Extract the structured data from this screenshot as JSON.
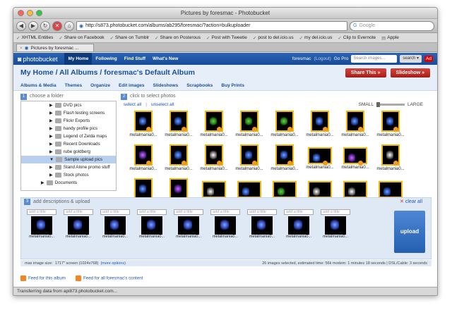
{
  "window": {
    "title": "Pictures by foresmac - Photobucket"
  },
  "browser": {
    "url": "http://s873.photobucket.com/albums/ab295/foresmac/?action=bulkuploader",
    "search_placeholder": "Google",
    "bookmarks": [
      "XHTML Entities",
      "Share on Facebook",
      "Share on Tumblr",
      "Share on Posterous",
      "Post with Tweetie",
      "post to del.icio.us",
      "my del.icio.us",
      "Clip to Evernote",
      "Apple"
    ],
    "tab_label": "Pictures by foresmac ...",
    "status": "Transferring data from api873.photobucket.com..."
  },
  "header": {
    "logo": "photobucket",
    "nav": [
      "My Home",
      "Following",
      "Find Stuff",
      "What's New"
    ],
    "user": "foresmac",
    "logout": "(Logout)",
    "gopro": "Go Pro",
    "search_placeholder": "Search images...",
    "search_scope": "search"
  },
  "crumb": {
    "text": "My Home / All Albums / foresmac's Default Album",
    "share": "Share This »",
    "slideshow": "Slideshow »"
  },
  "subnav": [
    "Albums & Media",
    "Themes",
    "Organize",
    "Edit images",
    "Slideshows",
    "Scrapbooks",
    "Buy Prints"
  ],
  "steps": {
    "one": "choose a folder",
    "two": "click to select photos",
    "three": "add descriptions & upload"
  },
  "folders": [
    "DVD pics",
    "Flash testing screens",
    "Flickr Exports",
    "handy profile pics",
    "Legend of Zelda maps",
    "Recent Downloads",
    "rube goldberg",
    "Sample upload pics",
    "Stand Alone promo stuff",
    "Stock photos",
    "Documents"
  ],
  "select": {
    "all": "select all",
    "unselect": "unselect all",
    "small": "SMALL",
    "large": "LARGE"
  },
  "thumb_label": "metalmania0...",
  "upload": {
    "clear": "clear all",
    "placeholder": "add a title",
    "button": "upload"
  },
  "info": {
    "max_size": "max image size:",
    "size_value": "1717\" screen (1024x768)",
    "more": "(more options)",
    "summary": "26 images selected, estimated time: 56k modem: 1 minutes 18 seconds | DSL/Cable: 3 seconds"
  },
  "feeds": [
    "Feed for this album",
    "Feed for all foresmac's content"
  ],
  "colors": {
    "brand_blue": "#174c98",
    "accent_red": "#c0312b",
    "thumb_border": "#f2b900"
  }
}
